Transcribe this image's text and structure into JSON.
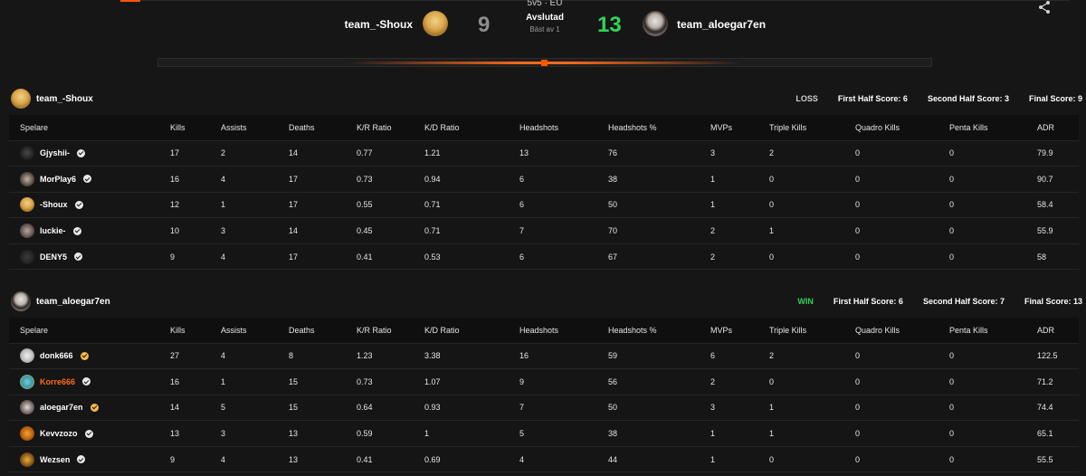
{
  "match": {
    "mode": "5v5 · EU",
    "status": "Avslutad",
    "best_of": "Bäst av 1",
    "team_left": "team_-Shoux",
    "team_right": "team_aloegar7en",
    "score_left": "9",
    "score_right": "13"
  },
  "columns": [
    "Spelare",
    "Kills",
    "Assists",
    "Deaths",
    "K/R Ratio",
    "K/D Ratio",
    "Headshots",
    "Headshots %",
    "MVPs",
    "Triple Kills",
    "Quadro Kills",
    "Penta Kills",
    "ADR"
  ],
  "teams": [
    {
      "name": "team_-Shoux",
      "result": "LOSS",
      "first_half": "First Half Score: 6",
      "second_half": "Second Half Score: 3",
      "final": "Final Score: 9",
      "players": [
        {
          "name": "Gjyshii-",
          "kills": "17",
          "assists": "2",
          "deaths": "14",
          "kr": "0.77",
          "kd": "1.21",
          "hs": "13",
          "hsp": "76",
          "mvps": "3",
          "triple": "2",
          "quadro": "0",
          "penta": "0",
          "adr": "79.9"
        },
        {
          "name": "MorPlay6",
          "kills": "16",
          "assists": "4",
          "deaths": "17",
          "kr": "0.73",
          "kd": "0.94",
          "hs": "6",
          "hsp": "38",
          "mvps": "1",
          "triple": "0",
          "quadro": "0",
          "penta": "0",
          "adr": "90.7"
        },
        {
          "name": "-Shoux",
          "kills": "12",
          "assists": "1",
          "deaths": "17",
          "kr": "0.55",
          "kd": "0.71",
          "hs": "6",
          "hsp": "50",
          "mvps": "1",
          "triple": "0",
          "quadro": "0",
          "penta": "0",
          "adr": "58.4"
        },
        {
          "name": "luckie-",
          "kills": "10",
          "assists": "3",
          "deaths": "14",
          "kr": "0.45",
          "kd": "0.71",
          "hs": "7",
          "hsp": "70",
          "mvps": "2",
          "triple": "1",
          "quadro": "0",
          "penta": "0",
          "adr": "55.9"
        },
        {
          "name": "DENY5",
          "kills": "9",
          "assists": "4",
          "deaths": "17",
          "kr": "0.41",
          "kd": "0.53",
          "hs": "6",
          "hsp": "67",
          "mvps": "2",
          "triple": "0",
          "quadro": "0",
          "penta": "0",
          "adr": "58"
        }
      ]
    },
    {
      "name": "team_aloegar7en",
      "result": "WIN",
      "first_half": "First Half Score: 6",
      "second_half": "Second Half Score: 7",
      "final": "Final Score: 13",
      "players": [
        {
          "name": "donk666",
          "kills": "27",
          "assists": "4",
          "deaths": "8",
          "kr": "1.23",
          "kd": "3.38",
          "hs": "16",
          "hsp": "59",
          "mvps": "6",
          "triple": "2",
          "quadro": "0",
          "penta": "0",
          "adr": "122.5"
        },
        {
          "name": "Korre666",
          "kills": "16",
          "assists": "1",
          "deaths": "15",
          "kr": "0.73",
          "kd": "1.07",
          "hs": "9",
          "hsp": "56",
          "mvps": "2",
          "triple": "0",
          "quadro": "0",
          "penta": "0",
          "adr": "71.2"
        },
        {
          "name": "aloegar7en",
          "kills": "14",
          "assists": "5",
          "deaths": "15",
          "kr": "0.64",
          "kd": "0.93",
          "hs": "7",
          "hsp": "50",
          "mvps": "3",
          "triple": "1",
          "quadro": "0",
          "penta": "0",
          "adr": "74.4"
        },
        {
          "name": "Kevvzozo",
          "kills": "13",
          "assists": "3",
          "deaths": "13",
          "kr": "0.59",
          "kd": "1",
          "hs": "5",
          "hsp": "38",
          "mvps": "1",
          "triple": "1",
          "quadro": "0",
          "penta": "0",
          "adr": "65.1"
        },
        {
          "name": "Wezsen",
          "kills": "9",
          "assists": "4",
          "deaths": "13",
          "kr": "0.41",
          "kd": "0.69",
          "hs": "4",
          "hsp": "44",
          "mvps": "1",
          "triple": "0",
          "quadro": "0",
          "penta": "0",
          "adr": "55.5"
        }
      ]
    }
  ],
  "icons": {
    "share": "share-icon",
    "verified": "verified-badge-icon"
  },
  "colors": {
    "accent": "#ff5500",
    "win": "#32d35a",
    "loss_score": "#8c8c8c",
    "highlight_name": "#ff6a1a"
  }
}
